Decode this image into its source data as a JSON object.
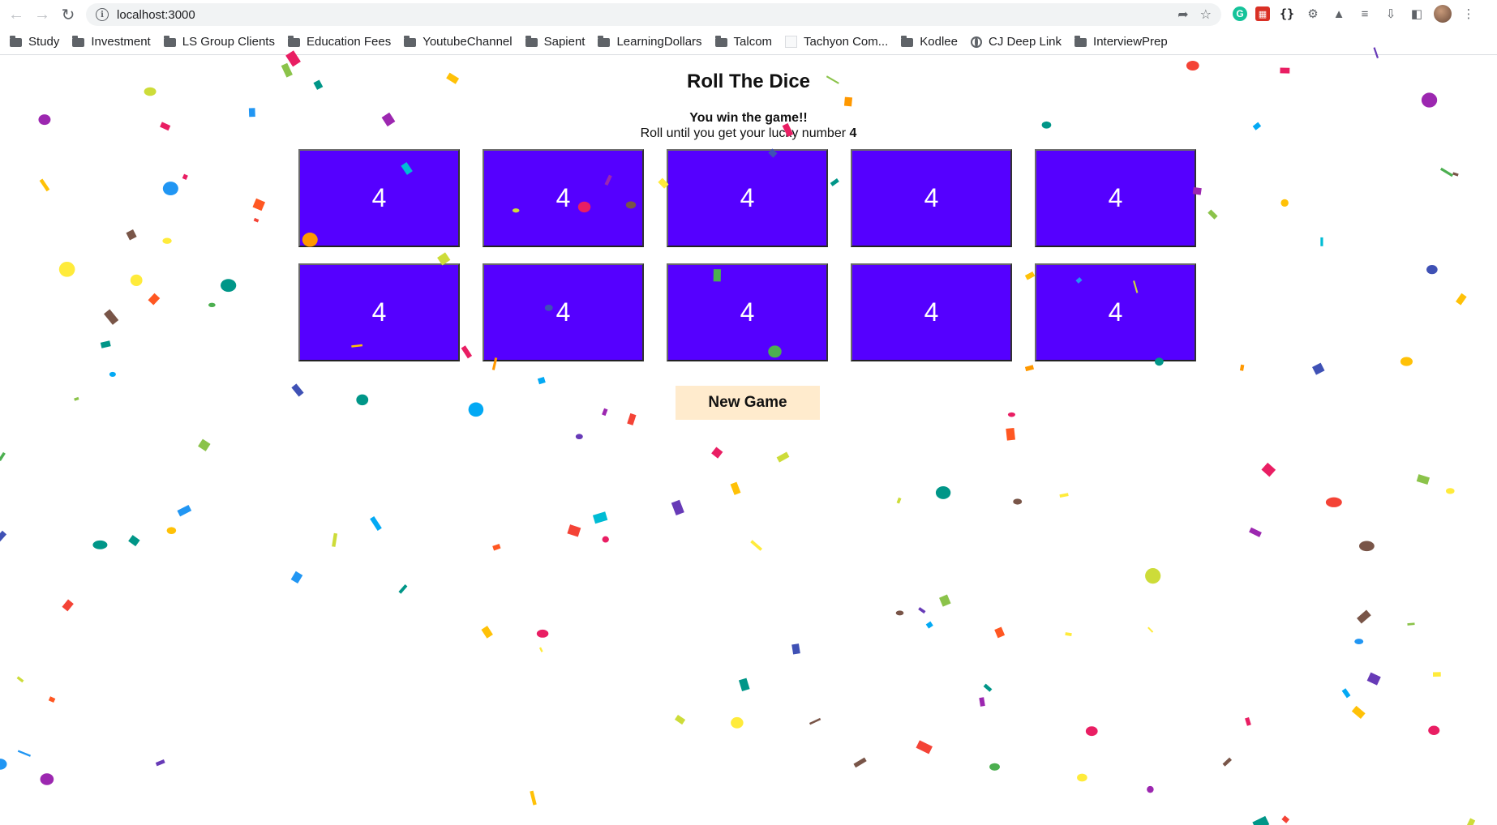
{
  "browser": {
    "url": "localhost:3000",
    "bookmarks": [
      {
        "label": "Study",
        "icon": "folder-icon"
      },
      {
        "label": "Investment",
        "icon": "folder-icon"
      },
      {
        "label": "LS Group Clients",
        "icon": "folder-icon"
      },
      {
        "label": "Education Fees",
        "icon": "folder-icon"
      },
      {
        "label": "YoutubeChannel",
        "icon": "folder-icon"
      },
      {
        "label": "Sapient",
        "icon": "folder-icon"
      },
      {
        "label": "LearningDollars",
        "icon": "folder-icon"
      },
      {
        "label": "Talcom",
        "icon": "folder-icon"
      },
      {
        "label": "Tachyon Com...",
        "icon": "blank-page-icon"
      },
      {
        "label": "Kodlee",
        "icon": "folder-icon"
      },
      {
        "label": "CJ Deep Link",
        "icon": "globe-icon"
      },
      {
        "label": "InterviewPrep",
        "icon": "folder-icon"
      }
    ]
  },
  "game": {
    "title": "Roll The Dice",
    "status": "You win the game!!",
    "instruction": "Roll until you get your lucky number",
    "lucky_number": "4",
    "dice": [
      "4",
      "4",
      "4",
      "4",
      "4",
      "4",
      "4",
      "4",
      "4",
      "4"
    ],
    "new_game_label": "New Game",
    "colors": {
      "die": "#5500ff",
      "button": "#ffebcd"
    }
  }
}
